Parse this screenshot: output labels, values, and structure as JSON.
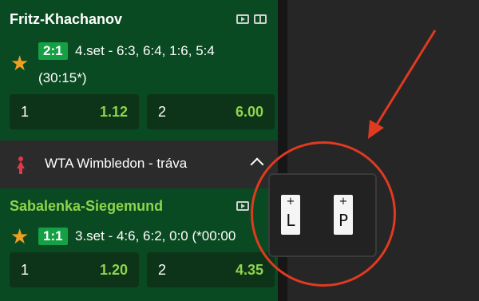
{
  "match1": {
    "title": "Fritz-Khachanov",
    "score_badge": "2:1",
    "score_line1": "4.set - 6:3, 6:4, 1:6, 5:4",
    "score_line2": "(30:15*)",
    "odds": [
      {
        "label": "1",
        "value": "1.12"
      },
      {
        "label": "2",
        "value": "6.00"
      }
    ]
  },
  "league": {
    "name": "WTA Wimbledon - tráva"
  },
  "match2": {
    "title": "Sabalenka-Siegemund",
    "score_badge": "1:1",
    "score_line1": "3.set - 4:6, 6:2, 0:0 (*00:00",
    "odds": [
      {
        "label": "1",
        "value": "1.20"
      },
      {
        "label": "2",
        "value": "4.35"
      }
    ]
  },
  "toolbar": {
    "left_card_symbol": "+",
    "left_card_letter": "L",
    "right_card_symbol": "+",
    "right_card_letter": "P"
  },
  "colors": {
    "accent_green": "#8ed44c",
    "badge_green": "#15a045",
    "annotation_red": "#e03a20",
    "star_orange": "#f0a020"
  }
}
